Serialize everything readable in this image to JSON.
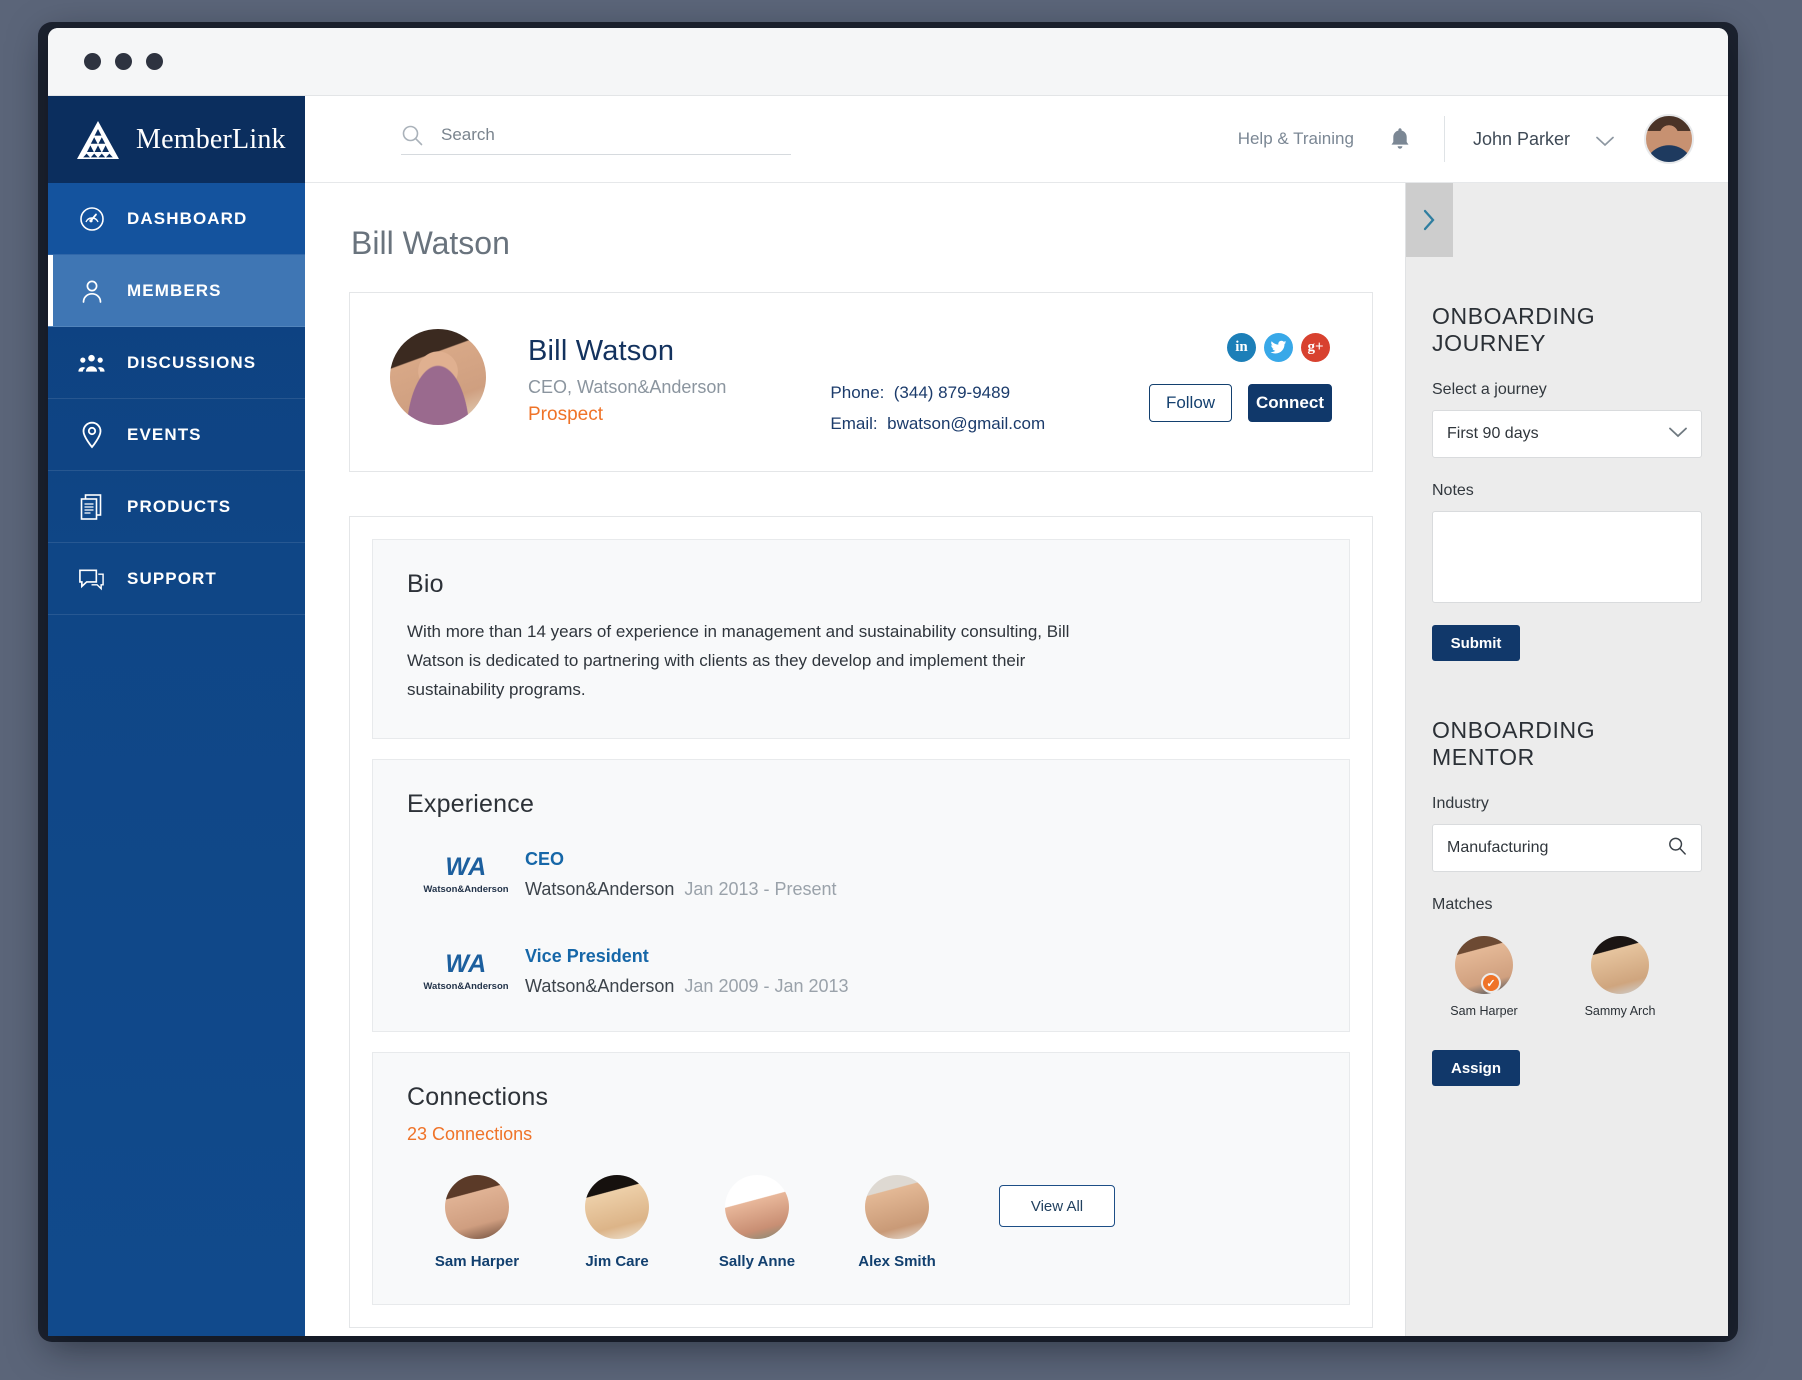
{
  "window": {
    "dots": 3
  },
  "brand": {
    "name": "MemberLink",
    "logo_icon": "triangle-logo-icon"
  },
  "sidebar": {
    "items": [
      {
        "label": "DASHBOARD",
        "icon": "dashboard-gauge-icon",
        "state": "dashboard"
      },
      {
        "label": "MEMBERS",
        "icon": "person-icon",
        "state": "active"
      },
      {
        "label": "DISCUSSIONS",
        "icon": "people-group-icon",
        "state": ""
      },
      {
        "label": "EVENTS",
        "icon": "map-pin-icon",
        "state": ""
      },
      {
        "label": "PRODUCTS",
        "icon": "documents-icon",
        "state": ""
      },
      {
        "label": "SUPPORT",
        "icon": "chat-bubble-icon",
        "state": ""
      }
    ]
  },
  "topbar": {
    "search_placeholder": "Search",
    "search_value": "",
    "search_icon": "search-icon",
    "help_label": "Help & Training",
    "bell_icon": "notification-bell-icon",
    "user_name": "John Parker",
    "chevron_icon": "chevron-down-icon",
    "avatar": "user-avatar"
  },
  "page": {
    "title": "Bill Watson"
  },
  "profile": {
    "name": "Bill Watson",
    "title": "CEO, Watson&Anderson",
    "status": "Prospect",
    "phone_label": "Phone:",
    "phone_value": "(344) 879-9489",
    "email_label": "Email:",
    "email_value": "bwatson@gmail.com",
    "socials": [
      {
        "name": "linkedin-icon",
        "glyph": "in",
        "color": "#1c7fb8"
      },
      {
        "name": "twitter-icon",
        "glyph": "t",
        "color": "#38a8e8"
      },
      {
        "name": "google-plus-icon",
        "glyph": "g+",
        "color": "#d8412f"
      }
    ],
    "follow_label": "Follow",
    "connect_label": "Connect"
  },
  "bio": {
    "heading": "Bio",
    "text": "With more than 14 years of experience in management and sustainability consulting,  Bill Watson is dedicated to partnering with clients as they develop and implement their sustainability programs."
  },
  "experience": {
    "heading": "Experience",
    "items": [
      {
        "logo_text": "WA",
        "logo_sub": "Watson&Anderson",
        "role": "CEO",
        "company": "Watson&Anderson",
        "dates": "Jan 2013 - Present"
      },
      {
        "logo_text": "WA",
        "logo_sub": "Watson&Anderson",
        "role": "Vice President",
        "company": "Watson&Anderson",
        "dates": "Jan 2009 - Jan 2013"
      }
    ]
  },
  "connections": {
    "heading": "Connections",
    "count_label": "23 Connections",
    "people": [
      {
        "name": "Sam Harper"
      },
      {
        "name": "Jim Care"
      },
      {
        "name": "Sally Anne"
      },
      {
        "name": "Alex Smith"
      }
    ],
    "view_all_label": "View All"
  },
  "right_panel": {
    "collapse_icon": "chevron-right-icon",
    "journey": {
      "heading": "ONBOARDING JOURNEY",
      "select_label": "Select a journey",
      "select_value": "First 90 days",
      "select_icon": "chevron-down-icon",
      "notes_label": "Notes",
      "notes_value": "",
      "submit_label": "Submit"
    },
    "mentor": {
      "heading": "ONBOARDING MENTOR",
      "industry_label": "Industry",
      "industry_value": "Manufacturing",
      "industry_icon": "search-icon",
      "matches_label": "Matches",
      "matches": [
        {
          "name": "Sam Harper",
          "selected": true,
          "check_icon": "check-circle-icon"
        },
        {
          "name": "Sammy Arch",
          "selected": false,
          "check_icon": ""
        }
      ],
      "assign_label": "Assign"
    }
  },
  "colors": {
    "brand_navy": "#0b2e5e",
    "sidebar_blue": "#114a8c",
    "active_blue": "#3f76b4",
    "accent_orange": "#ef7328",
    "link_blue": "#1667a8",
    "button_navy": "#11386a"
  }
}
